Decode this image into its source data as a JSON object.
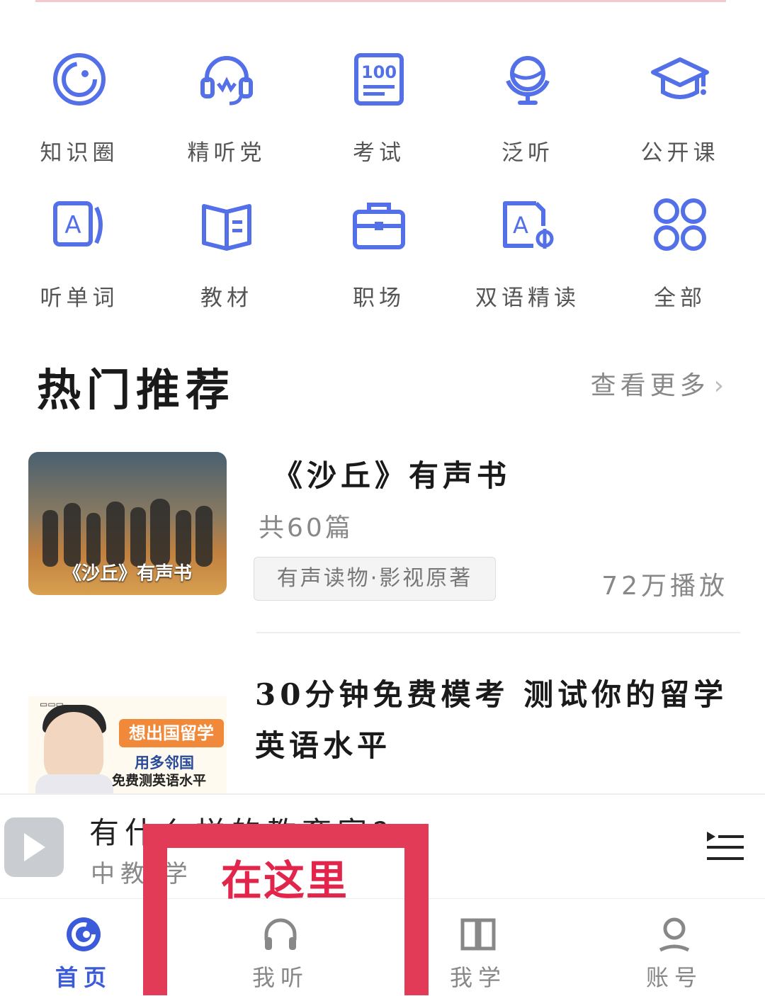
{
  "colors": {
    "accent": "#3b5bdb",
    "icon_blue": "#5470e8",
    "highlight": "#e23b58"
  },
  "categories": [
    {
      "label": "知识圈",
      "icon": "circle-icon"
    },
    {
      "label": "精听党",
      "icon": "headset-icon"
    },
    {
      "label": "考试",
      "icon": "score-100-icon"
    },
    {
      "label": "泛听",
      "icon": "globe-icon"
    },
    {
      "label": "公开课",
      "icon": "graduation-cap-icon"
    },
    {
      "label": "听单词",
      "icon": "word-card-icon"
    },
    {
      "label": "教材",
      "icon": "book-icon"
    },
    {
      "label": "职场",
      "icon": "briefcase-icon"
    },
    {
      "label": "双语精读",
      "icon": "bilingual-icon"
    },
    {
      "label": "全部",
      "icon": "grid-icon"
    }
  ],
  "hot": {
    "title": "热门推荐",
    "more": "查看更多",
    "more_chevron": "›"
  },
  "card1": {
    "thumb_caption": "《沙丘》有声书",
    "title": "《沙丘》有声书",
    "count": "共60篇",
    "tag": "有声读物·影视原著",
    "plays": "72万播放"
  },
  "card2": {
    "title": "30分钟免费模考 测试你的留学英语水平",
    "thumb_text1": "想出国留学",
    "thumb_text2": "用多邻国",
    "thumb_text3": "免费测英语水平"
  },
  "player": {
    "title": "有什么样的教育家?",
    "subtitle": "中教 学"
  },
  "tabs": [
    {
      "label": "首页",
      "icon": "home-circle-icon",
      "active": true
    },
    {
      "label": "我听",
      "icon": "headphones-icon",
      "active": false
    },
    {
      "label": "我学",
      "icon": "open-book-icon",
      "active": false
    },
    {
      "label": "账号",
      "icon": "person-icon",
      "active": false
    }
  ],
  "annotation": {
    "text": "在这里"
  }
}
